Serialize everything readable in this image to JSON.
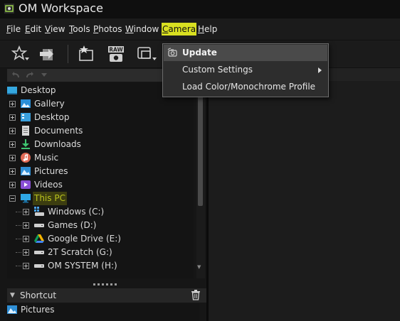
{
  "window": {
    "title": "OM Workspace"
  },
  "menu_bar": {
    "items": [
      "File",
      "Edit",
      "View",
      "Tools",
      "Photos",
      "Window",
      "Camera",
      "Help"
    ],
    "active": "Camera"
  },
  "camera_menu": {
    "items": [
      {
        "label": "Update",
        "icon": "camera-update-icon",
        "bold": true,
        "hover": true
      },
      {
        "label": "Custom Settings",
        "submenu": true
      },
      {
        "label": "Load Color/Monochrome Profile"
      }
    ]
  },
  "toolbar": {
    "icons": [
      "filter-star-icon",
      "import-arrow-icon",
      "star-collection-icon",
      "raw-camera-icon",
      "frame-stack-icon"
    ]
  },
  "folder_tree": {
    "root": {
      "label": "Desktop",
      "icon": "desktop-icon"
    },
    "items": [
      {
        "label": "Gallery",
        "icon": "gallery-icon"
      },
      {
        "label": "Desktop",
        "icon": "desktop-folder-icon"
      },
      {
        "label": "Documents",
        "icon": "documents-icon"
      },
      {
        "label": "Downloads",
        "icon": "download-icon"
      },
      {
        "label": "Music",
        "icon": "music-icon"
      },
      {
        "label": "Pictures",
        "icon": "pictures-icon"
      },
      {
        "label": "Videos",
        "icon": "videos-icon"
      },
      {
        "label": "This PC",
        "icon": "computer-icon",
        "selected": true,
        "expanded": true
      }
    ],
    "drives": [
      {
        "label": "Windows (C:)",
        "icon": "windows-drive-icon"
      },
      {
        "label": "Games (D:)",
        "icon": "drive-icon"
      },
      {
        "label": "Google Drive (E:)",
        "icon": "google-drive-icon"
      },
      {
        "label": "2T Scratch (G:)",
        "icon": "drive-icon"
      },
      {
        "label": "OM SYSTEM (H:)",
        "icon": "drive-icon"
      }
    ]
  },
  "shortcut": {
    "header": "Shortcut",
    "items": [
      {
        "label": "Pictures",
        "icon": "pictures-icon"
      }
    ]
  },
  "colors": {
    "menu_highlight": "#d9e021",
    "selection_text": "#b9c21e",
    "background": "#1f1f1f"
  }
}
